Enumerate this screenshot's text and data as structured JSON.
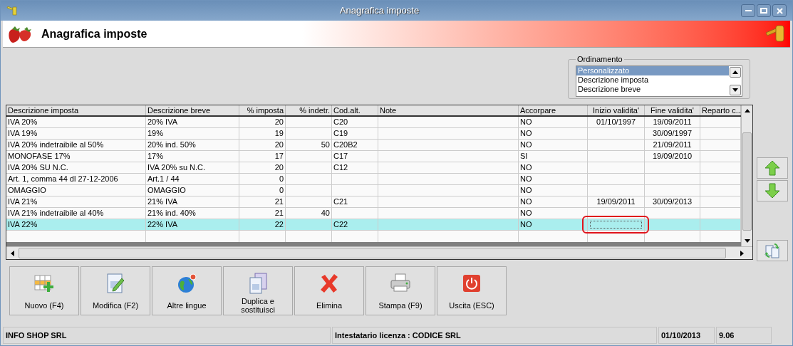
{
  "window": {
    "title": "Anagrafica imposte"
  },
  "header": {
    "title": "Anagrafica imposte"
  },
  "ordering": {
    "label": "Ordinamento",
    "items": [
      {
        "label": "Personalizzato",
        "selected": true
      },
      {
        "label": "Descrizione imposta",
        "selected": false
      },
      {
        "label": "Descrizione breve",
        "selected": false
      }
    ]
  },
  "table": {
    "columns": [
      {
        "label": "Descrizione imposta",
        "kind": "text",
        "marked": false
      },
      {
        "label": "Descrizione breve",
        "kind": "text",
        "marked": false
      },
      {
        "label": "% imposta",
        "kind": "number",
        "marked": false
      },
      {
        "label": "% indetr.",
        "kind": "number",
        "marked": false
      },
      {
        "label": "Cod.alt.",
        "kind": "text",
        "marked": false
      },
      {
        "label": "Note",
        "kind": "text",
        "marked": false
      },
      {
        "label": "Accorpare",
        "kind": "text",
        "marked": false
      },
      {
        "label": "Inizio validita'",
        "kind": "date",
        "marked": true
      },
      {
        "label": "Fine validita'",
        "kind": "date",
        "marked": false
      },
      {
        "label": "Reparto c...",
        "kind": "text",
        "marked": false
      }
    ],
    "rows": [
      {
        "cells": [
          "IVA 20%",
          "20% IVA",
          "20",
          "",
          "C20",
          "",
          "NO",
          "01/10/1997",
          "19/09/2011",
          ""
        ],
        "selected": false
      },
      {
        "cells": [
          "IVA 19%",
          "19%",
          "19",
          "",
          "C19",
          "",
          "NO",
          "",
          "30/09/1997",
          ""
        ],
        "selected": false
      },
      {
        "cells": [
          "IVA 20% indetraibile al 50%",
          "20% ind. 50%",
          "20",
          "50",
          "C20B2",
          "",
          "NO",
          "",
          "21/09/2011",
          ""
        ],
        "selected": false
      },
      {
        "cells": [
          "MONOFASE 17%",
          "17%",
          "17",
          "",
          "C17",
          "",
          "SI",
          "",
          "19/09/2010",
          ""
        ],
        "selected": false
      },
      {
        "cells": [
          "IVA 20% SU N.C.",
          "IVA 20% su N.C.",
          "20",
          "",
          "C12",
          "",
          "NO",
          "",
          "",
          ""
        ],
        "selected": false
      },
      {
        "cells": [
          "Art. 1, comma 44 dl 27-12-2006",
          "Art.1 / 44",
          "0",
          "",
          "",
          "",
          "NO",
          "",
          "",
          ""
        ],
        "selected": false
      },
      {
        "cells": [
          "OMAGGIO",
          "OMAGGIO",
          "0",
          "",
          "",
          "",
          "NO",
          "",
          "",
          ""
        ],
        "selected": false
      },
      {
        "cells": [
          "IVA 21%",
          "21% IVA",
          "21",
          "",
          "C21",
          "",
          "NO",
          "19/09/2011",
          "30/09/2013",
          ""
        ],
        "selected": false
      },
      {
        "cells": [
          "IVA 21% indetraibile al 40%",
          "21% ind. 40%",
          "21",
          "40",
          "",
          "",
          "NO",
          "",
          "",
          ""
        ],
        "selected": false
      },
      {
        "cells": [
          "IVA 22%",
          "22% IVA",
          "22",
          "",
          "C22",
          "",
          "NO",
          "",
          "",
          ""
        ],
        "selected": true
      }
    ]
  },
  "side_buttons": [
    {
      "kind": "up"
    },
    {
      "kind": "down"
    },
    {
      "kind": "refresh"
    }
  ],
  "buttons": [
    {
      "kind": "new",
      "label": "Nuovo (F4)"
    },
    {
      "kind": "edit",
      "label": "Modifica (F2)"
    },
    {
      "kind": "languages",
      "label": "Altre lingue"
    },
    {
      "kind": "duplicate",
      "label": "Duplica e sostituisci"
    },
    {
      "kind": "delete",
      "label": "Elimina"
    },
    {
      "kind": "print",
      "label": "Stampa (F9)"
    },
    {
      "kind": "exit",
      "label": "Uscita (ESC)"
    }
  ],
  "status_bar": {
    "company": "INFO SHOP SRL",
    "license": "Intestatario licenza : CODICE SRL",
    "date": "01/10/2013",
    "version": "9.06"
  }
}
